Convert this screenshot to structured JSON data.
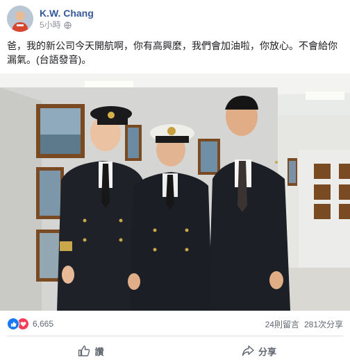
{
  "post": {
    "author": "K.W. Chang",
    "time": "5小時",
    "text": "爸，我的新公司今天開航啊，你有高興麼，我們會加油啦，你放心。不會給你漏氣。(台語發音)。"
  },
  "reactions": {
    "count": "6,665",
    "comments": "24則留言",
    "shares": "281次分享",
    "icons": [
      "like-icon",
      "love-icon"
    ]
  },
  "actions": {
    "like": "讚",
    "share": "分享"
  },
  "colors": {
    "author": "#365899",
    "like": "#1877f2",
    "love": "#f33e58"
  }
}
